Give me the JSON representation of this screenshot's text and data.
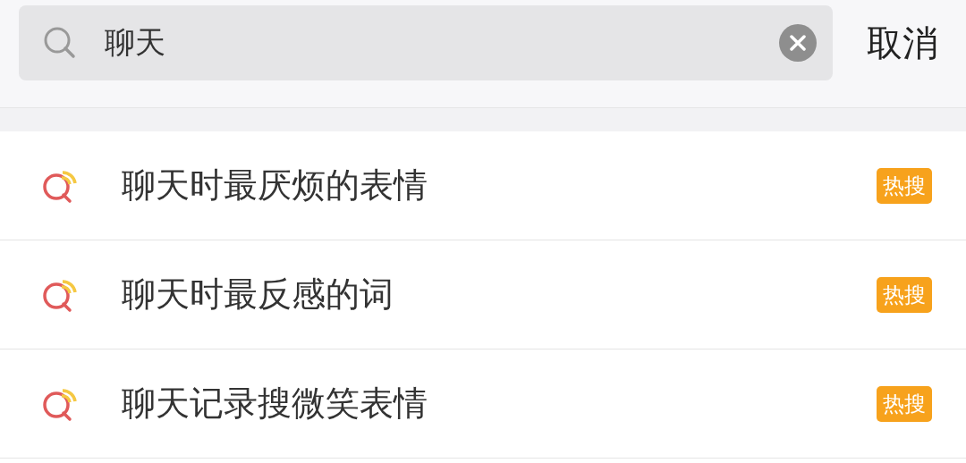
{
  "search": {
    "value": "聊天",
    "cancel": "取消"
  },
  "suggestions": [
    {
      "text": "聊天时最厌烦的表情",
      "badge": "热搜"
    },
    {
      "text": "聊天时最反感的词",
      "badge": "热搜"
    },
    {
      "text": "聊天记录搜微笑表情",
      "badge": "热搜"
    }
  ]
}
